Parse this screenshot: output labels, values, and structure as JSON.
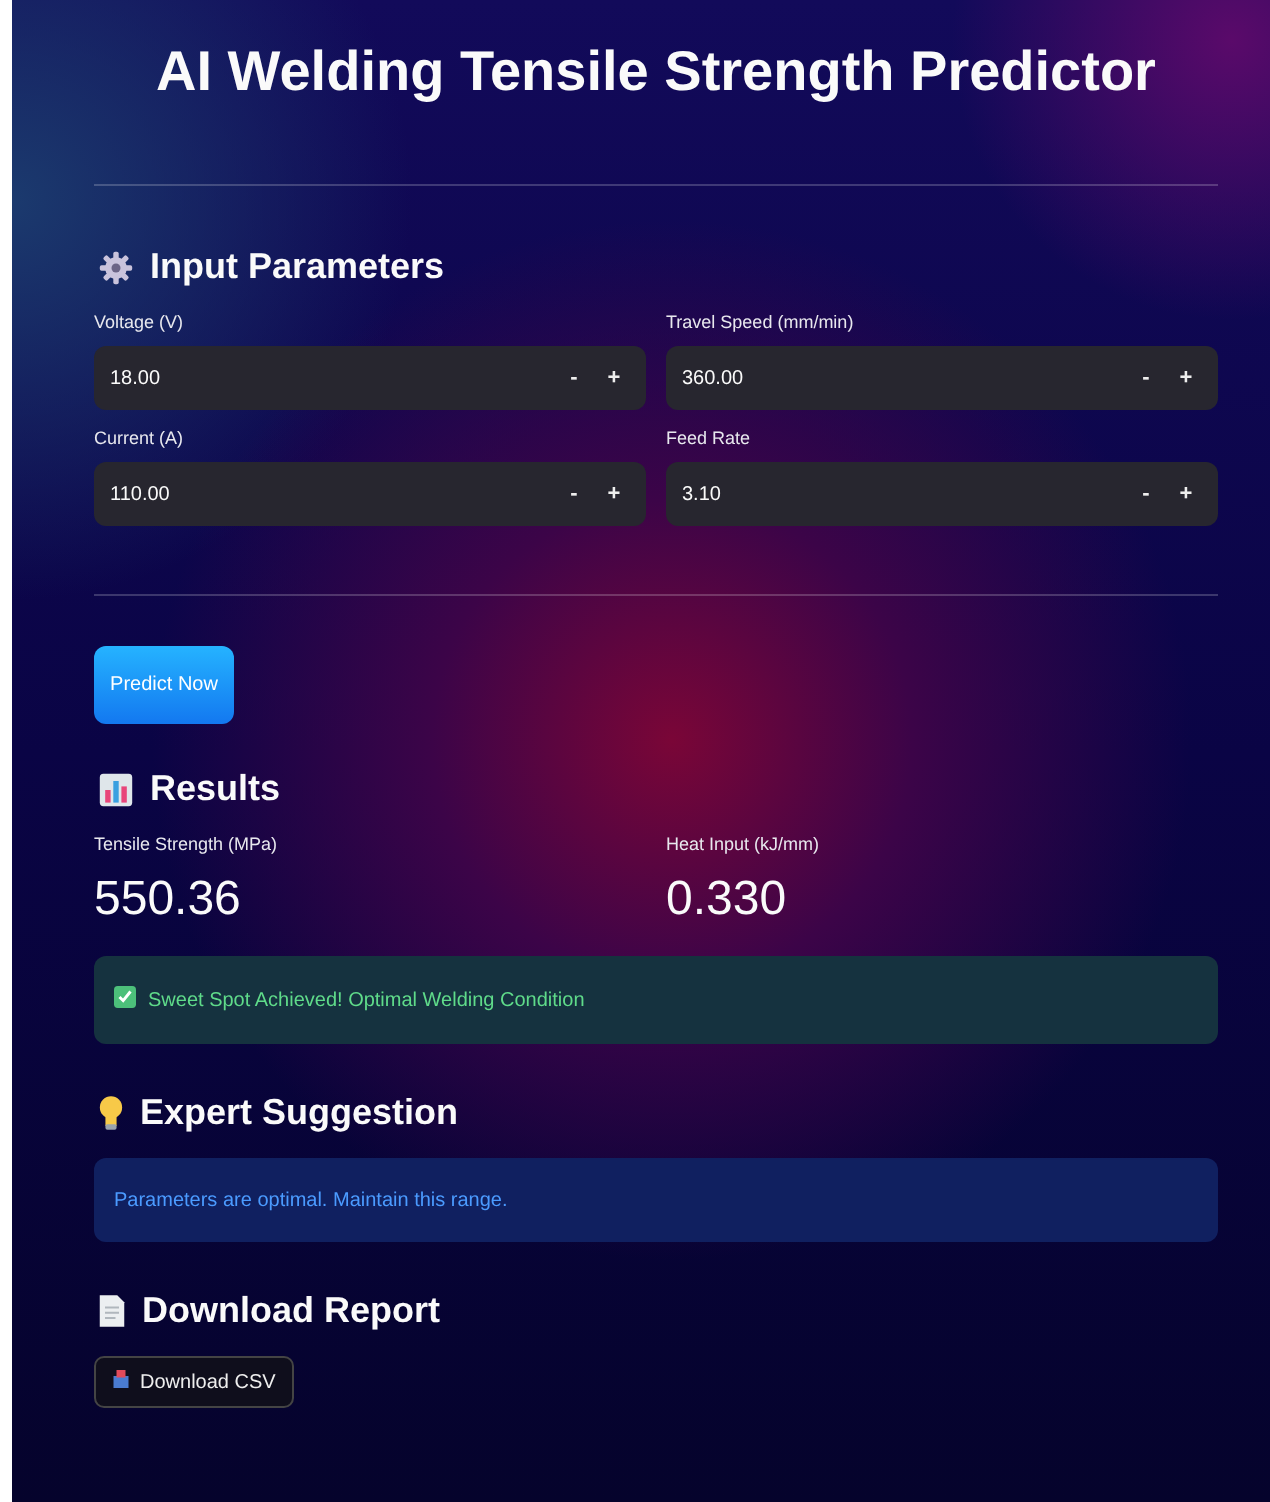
{
  "title": "AI Welding Tensile Strength Predictor",
  "input_section": {
    "heading": "Input Parameters",
    "fields": [
      {
        "label": "Voltage (V)",
        "value": "18.00",
        "minus": "-",
        "plus": "+"
      },
      {
        "label": "Travel Speed (mm/min)",
        "value": "360.00",
        "minus": "-",
        "plus": "+"
      },
      {
        "label": "Current (A)",
        "value": "110.00",
        "minus": "-",
        "plus": "+"
      },
      {
        "label": "Feed Rate",
        "value": "3.10",
        "minus": "-",
        "plus": "+"
      }
    ]
  },
  "predict_button": "Predict Now",
  "results": {
    "heading": "Results",
    "metrics": [
      {
        "label": "Tensile Strength (MPa)",
        "value": "550.36"
      },
      {
        "label": "Heat Input (kJ/mm)",
        "value": "0.330"
      }
    ],
    "alert": {
      "kind": "success",
      "text": "Sweet Spot Achieved! Optimal Welding Condition"
    }
  },
  "suggestion": {
    "heading": "Expert Suggestion",
    "alert": {
      "kind": "info",
      "text": "Parameters are optimal. Maintain this range."
    }
  },
  "download": {
    "heading": "Download Report",
    "button": "Download CSV"
  }
}
